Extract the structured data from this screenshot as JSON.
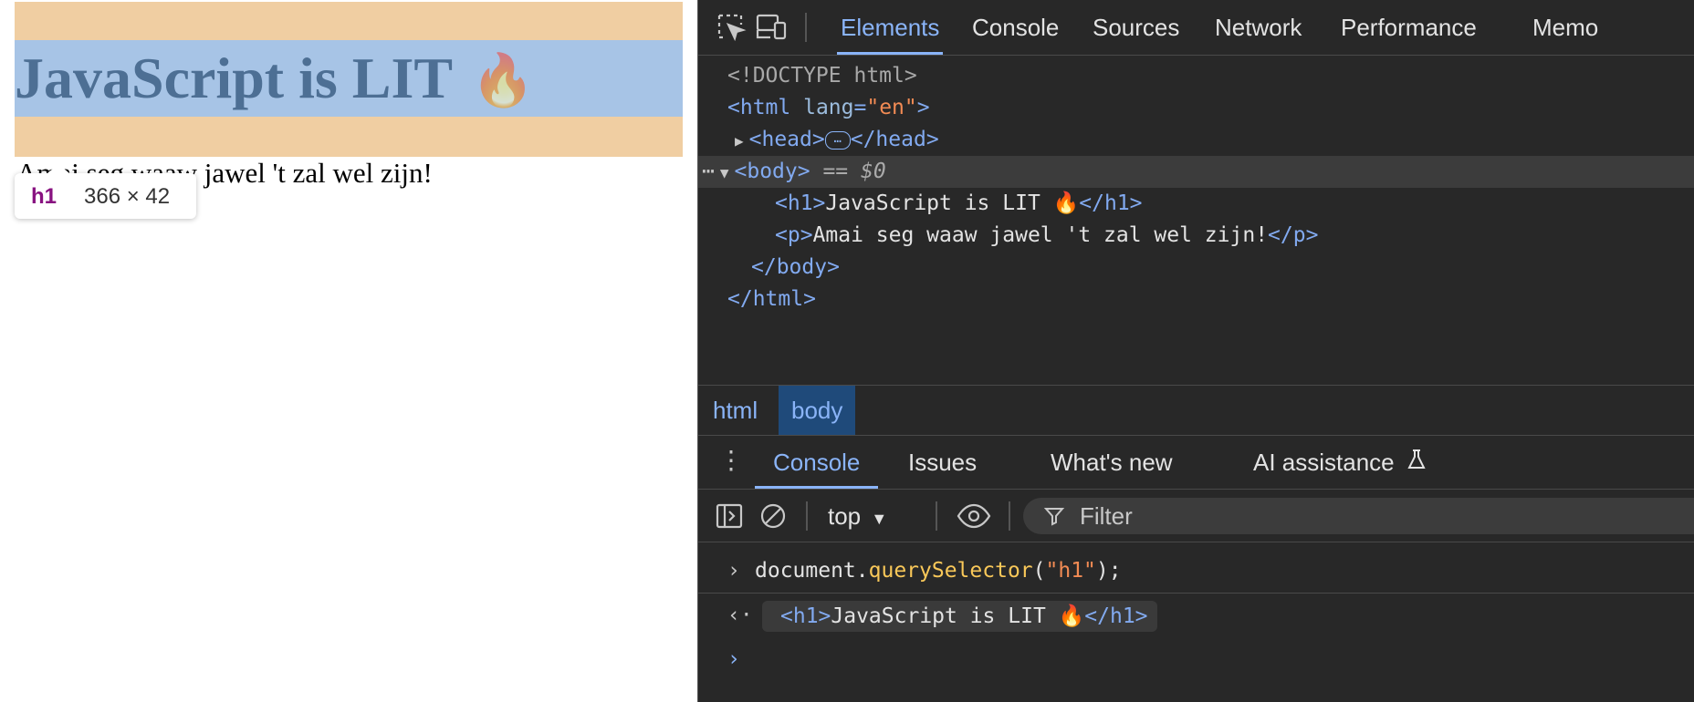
{
  "page": {
    "h1_text": "JavaScript is LIT",
    "h1_emoji": "🔥",
    "paragraph_text": "Amai seg waaw jawel 't zal wel zijn!",
    "tooltip": {
      "tag": "h1",
      "size": "366 × 42"
    }
  },
  "devtools": {
    "icons": {
      "inspect": "inspect-element-icon",
      "device": "device-toolbar-icon"
    },
    "tabs": [
      "Elements",
      "Console",
      "Sources",
      "Network",
      "Performance",
      "Memo"
    ],
    "active_tab": "Elements",
    "dom": {
      "doctype": "<!DOCTYPE html>",
      "html_open_tag": "<html",
      "html_attr_name": "lang",
      "html_attr_value": "\"en\"",
      "html_close_bracket": ">",
      "head_open": "<head>",
      "head_close": "</head>",
      "head_ellipsis": "…",
      "body_open": "<body>",
      "body_marker": "== $0",
      "h1_open": "<h1>",
      "h1_content": "JavaScript is LIT 🔥",
      "h1_close": "</h1>",
      "p_open": "<p>",
      "p_content": "Amai seg waaw jawel 't zal wel zijn!",
      "p_close": "</p>",
      "body_close": "</body>",
      "html_close": "</html>"
    },
    "breadcrumbs": [
      "html",
      "body"
    ],
    "drawer_tabs": [
      "Console",
      "Issues",
      "What's new",
      "AI assistance"
    ],
    "console_toolbar": {
      "context": "top",
      "filter_placeholder": "Filter"
    },
    "console": {
      "input_object": "document.",
      "input_method": "querySelector",
      "input_open": "(",
      "input_arg": "\"h1\"",
      "input_close": ");",
      "output_open": "<h1>",
      "output_content": "JavaScript is LIT 🔥",
      "output_close": "</h1>"
    },
    "colors": {
      "accent": "#8ab4f8",
      "panel_bg": "#282828",
      "tag": "#82aaf0"
    }
  }
}
